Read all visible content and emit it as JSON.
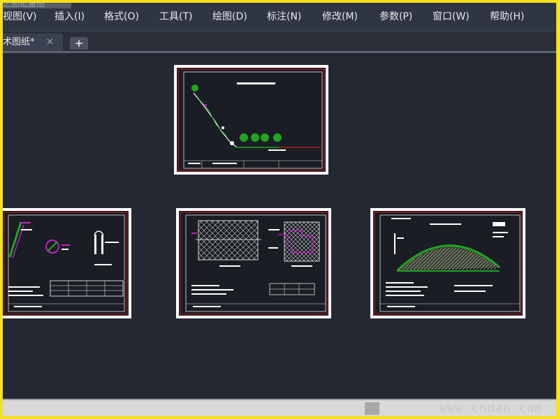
{
  "app": {
    "ghost_title": "艺图批量图"
  },
  "menu": {
    "items": [
      {
        "label": "视图(V)"
      },
      {
        "label": "插入(I)"
      },
      {
        "label": "格式(O)"
      },
      {
        "label": "工具(T)"
      },
      {
        "label": "绘图(D)"
      },
      {
        "label": "标注(N)"
      },
      {
        "label": "修改(M)"
      },
      {
        "label": "参数(P)"
      },
      {
        "label": "窗口(W)"
      },
      {
        "label": "帮助(H)"
      }
    ]
  },
  "tabs": {
    "active_label": "术图纸*",
    "close_glyph": "✕",
    "new_glyph": "+"
  },
  "colors": {
    "background": "#232833",
    "sheet_border": "#8b1a1a",
    "vegetation": "#1fa51f",
    "accent_magenta": "#c020c0"
  },
  "status": {
    "watermark": "www.cndao.com"
  }
}
